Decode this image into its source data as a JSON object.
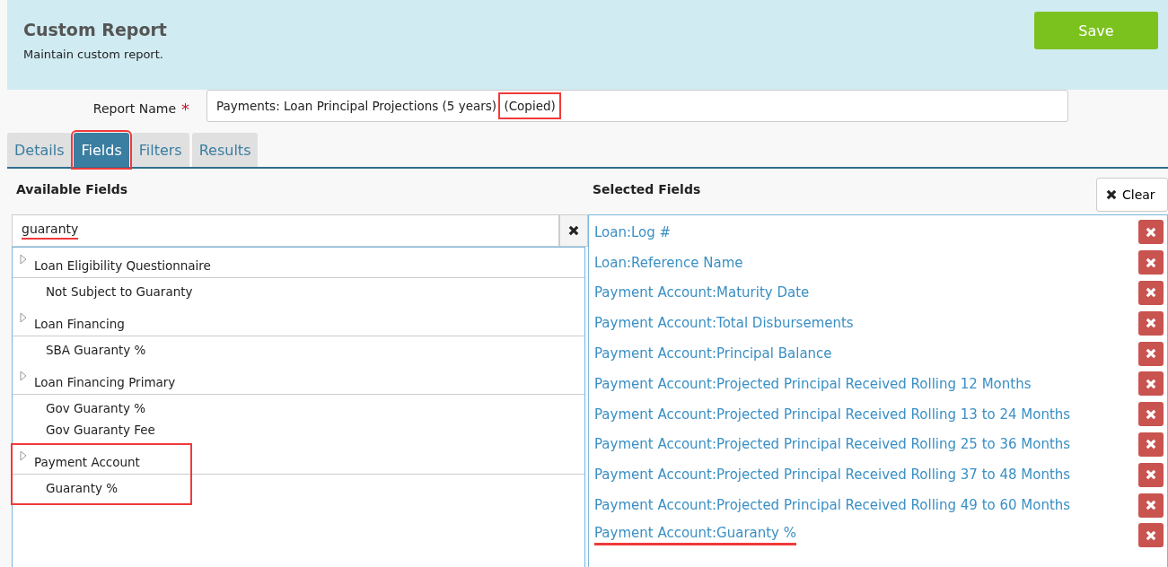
{
  "header": {
    "title": "Custom Report",
    "subtitle": "Maintain custom report.",
    "save_button": "Save"
  },
  "report_name": {
    "label": "Report Name",
    "required_mark": "*",
    "value_parts": [
      {
        "text": "Payments: Loan Principal Projections (5 years)",
        "highlighted": false
      },
      {
        "text": " (Copied)",
        "highlighted": true
      }
    ]
  },
  "tabs": [
    {
      "label": "Details",
      "selected": false,
      "highlighted": false
    },
    {
      "label": "Fields",
      "selected": true,
      "highlighted": true
    },
    {
      "label": "Filters",
      "selected": false,
      "highlighted": false
    },
    {
      "label": "Results",
      "selected": false,
      "highlighted": false
    }
  ],
  "available_fields": {
    "heading": "Available Fields",
    "search": {
      "value": "guaranty",
      "underlined": true
    },
    "tree": [
      {
        "label": "Loan Eligibility Questionnaire",
        "highlighted": false,
        "children": [
          {
            "label": "Not Subject to Guaranty"
          }
        ]
      },
      {
        "label": "Loan Financing",
        "highlighted": false,
        "children": [
          {
            "label": "SBA Guaranty %"
          }
        ]
      },
      {
        "label": "Loan Financing Primary",
        "highlighted": false,
        "children": [
          {
            "label": "Gov Guaranty %"
          },
          {
            "label": "Gov Guaranty Fee"
          }
        ]
      },
      {
        "label": "Payment Account",
        "highlighted": true,
        "children": [
          {
            "label": "Guaranty %"
          }
        ]
      }
    ]
  },
  "selected_fields": {
    "heading": "Selected Fields",
    "clear_button": "Clear",
    "items": [
      {
        "label": "Loan:Log #",
        "underlined": false
      },
      {
        "label": "Loan:Reference Name",
        "underlined": false
      },
      {
        "label": "Payment Account:Maturity Date",
        "underlined": false
      },
      {
        "label": "Payment Account:Total Disbursements",
        "underlined": false
      },
      {
        "label": "Payment Account:Principal Balance",
        "underlined": false
      },
      {
        "label": "Payment Account:Projected Principal Received Rolling 12 Months",
        "underlined": false
      },
      {
        "label": "Payment Account:Projected Principal Received Rolling 13 to 24 Months",
        "underlined": false
      },
      {
        "label": "Payment Account:Projected Principal Received Rolling 25 to 36 Months",
        "underlined": false
      },
      {
        "label": "Payment Account:Projected Principal Received Rolling 37 to 48 Months",
        "underlined": false
      },
      {
        "label": "Payment Account:Projected Principal Received Rolling 49 to 60 Months",
        "underlined": false
      },
      {
        "label": "Payment Account:Guaranty %",
        "underlined": true
      }
    ]
  }
}
